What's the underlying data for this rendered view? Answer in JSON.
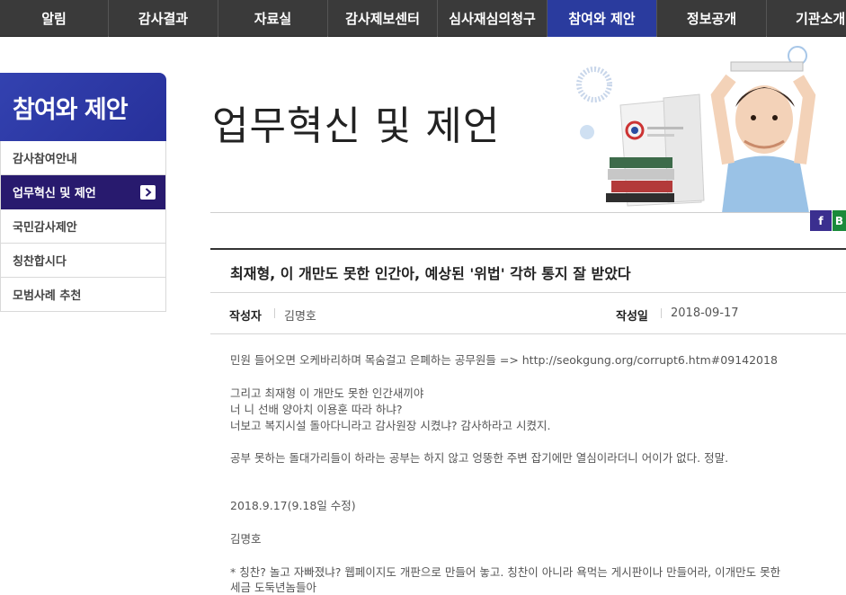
{
  "topnav": {
    "items": [
      {
        "label": "알림"
      },
      {
        "label": "감사결과"
      },
      {
        "label": "자료실"
      },
      {
        "label": "감사제보센터"
      },
      {
        "label": "심사재심의청구"
      },
      {
        "label": "참여와 제안"
      },
      {
        "label": "정보공개"
      },
      {
        "label": "기관소개"
      }
    ],
    "active_index": 5
  },
  "sidebar": {
    "title": "참여와 제안",
    "items": [
      {
        "label": "감사참여안내"
      },
      {
        "label": "업무혁신 및 제언"
      },
      {
        "label": "국민감사제안"
      },
      {
        "label": "칭찬합시다"
      },
      {
        "label": "모범사례 추천"
      }
    ],
    "active_index": 1
  },
  "page": {
    "title": "업무혁신 및 제언"
  },
  "share": {
    "facebook": "f",
    "other": "B"
  },
  "article": {
    "title": "최재형, 이 개만도 못한 인간아, 예상된 '위법' 각하 통지 잘 받았다",
    "author_label": "작성자",
    "author": "김명호",
    "date_label": "작성일",
    "date": "2018-09-17",
    "body": [
      "민원 들어오면 오케바리하며 목숨걸고 은폐하는 공무원들 => http://seokgung.org/corrupt6.htm#09142018",
      "그리고 최재형 이 개만도 못한 인간새끼야",
      "너 니 선배 양아치 이용훈 따라 하냐?",
      "너보고 복지시설 돌아다니라고 감사원장 시켰냐? 감사하라고 시켰지.",
      "공부 못하는 돌대가리들이 하라는 공부는 하지 않고 엉뚱한 주변 잡기에만 열심이라더니 어이가 없다. 정말.",
      "2018.9.17(9.18일 수정)",
      "김명호",
      "* 칭찬? 놀고 자빠졌냐? 웹페이지도 개판으로 만들어 놓고. 칭찬이 아니라 욕먹는 게시판이나 만들어라, 이개만도 못한",
      "세금 도둑년놈들아"
    ]
  },
  "colors": {
    "nav_bg": "#3a3a3a",
    "nav_active": "#2a3b9e",
    "sidebar_title": "#2f3ca8",
    "sidebar_active": "#281a6e",
    "facebook": "#3b2f8f",
    "green": "#1a8a3a"
  }
}
